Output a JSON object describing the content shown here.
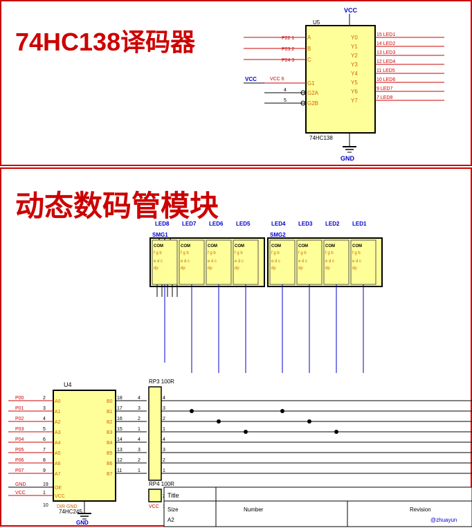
{
  "top_section": {
    "title": "74HC138译码器",
    "ic_name": "74HC138",
    "ic_label": "U5",
    "vcc": "VCC",
    "gnd": "GND",
    "left_pins": [
      {
        "num": "1",
        "name": "A",
        "port": "P22"
      },
      {
        "num": "2",
        "name": "B",
        "port": "P23"
      },
      {
        "num": "3",
        "name": "C",
        "port": "P24"
      },
      {
        "num": "6",
        "name": "G1",
        "port": "VCC"
      },
      {
        "num": "4",
        "name": "G2A",
        "port": ""
      },
      {
        "num": "5",
        "name": "G2B",
        "port": ""
      }
    ],
    "right_pins": [
      {
        "num": "15",
        "name": "Y0",
        "led": "LED1"
      },
      {
        "num": "14",
        "name": "Y1",
        "led": "LED2"
      },
      {
        "num": "13",
        "name": "Y2",
        "led": "LED3"
      },
      {
        "num": "12",
        "name": "Y3",
        "led": "LED4"
      },
      {
        "num": "11",
        "name": "Y4",
        "led": "LED5"
      },
      {
        "num": "10",
        "name": "Y5",
        "led": "LED6"
      },
      {
        "num": "9",
        "name": "Y6",
        "led": "LED7"
      },
      {
        "num": "7",
        "name": "Y7",
        "led": "LED8"
      }
    ]
  },
  "bottom_section": {
    "title": "动态数码管模块",
    "smg1_label": "SMG1",
    "smg2_label": "SMG2",
    "leds": [
      "LED8",
      "LED7",
      "LED6",
      "LED5",
      "LED4",
      "LED3",
      "LED2",
      "LED1"
    ],
    "digits": [
      {
        "com": "COM",
        "segs": "f g b\ne d c dp"
      },
      {
        "com": "COM",
        "segs": "f g b\ne d c dp"
      },
      {
        "com": "COM",
        "segs": "f g b\ne d c dp"
      },
      {
        "com": "COM",
        "segs": "f g b\ne d c dp"
      },
      {
        "com": "COM",
        "segs": "f g b\ne d c dp"
      },
      {
        "com": "COM",
        "segs": "f g b\ne d c dp"
      },
      {
        "com": "COM",
        "segs": "f g b\ne d c dp"
      },
      {
        "com": "COM",
        "segs": "f g b\ne d c dp"
      }
    ],
    "u4": {
      "label": "U4",
      "name": "74HC245",
      "left_pins": [
        {
          "num": "2",
          "name": "A0",
          "port": "P00"
        },
        {
          "num": "3",
          "name": "A1",
          "port": "P01"
        },
        {
          "num": "4",
          "name": "A2",
          "port": "P02"
        },
        {
          "num": "5",
          "name": "A3",
          "port": "P03"
        },
        {
          "num": "6",
          "name": "A4",
          "port": "P04"
        },
        {
          "num": "7",
          "name": "A5",
          "port": "P05"
        },
        {
          "num": "8",
          "name": "A6",
          "port": "P06"
        },
        {
          "num": "9",
          "name": "A7",
          "port": "P07"
        },
        {
          "num": "19",
          "name": "OE",
          "port": "GND"
        },
        {
          "num": "1",
          "name": "VCC",
          "port": "VCC"
        }
      ],
      "right_pins": [
        {
          "num": "18",
          "name": "B0",
          "rp": "4"
        },
        {
          "num": "17",
          "name": "B1",
          "rp": "3"
        },
        {
          "num": "16",
          "name": "B2",
          "rp": "2"
        },
        {
          "num": "15",
          "name": "B3",
          "rp": "1"
        },
        {
          "num": "14",
          "name": "B4",
          "rp": "4"
        },
        {
          "num": "13",
          "name": "B5",
          "rp": "3"
        },
        {
          "num": "12",
          "name": "B6",
          "rp": "2"
        },
        {
          "num": "11",
          "name": "B7",
          "rp": "1"
        }
      ]
    },
    "rp3": "RP3 100R",
    "rp4": "RP4 100R",
    "title_block": {
      "title_label": "Title",
      "size_label": "Size",
      "size_val": "A2",
      "number_label": "Number",
      "revision_label": "Revision"
    },
    "watermark": "@zhuayun"
  }
}
